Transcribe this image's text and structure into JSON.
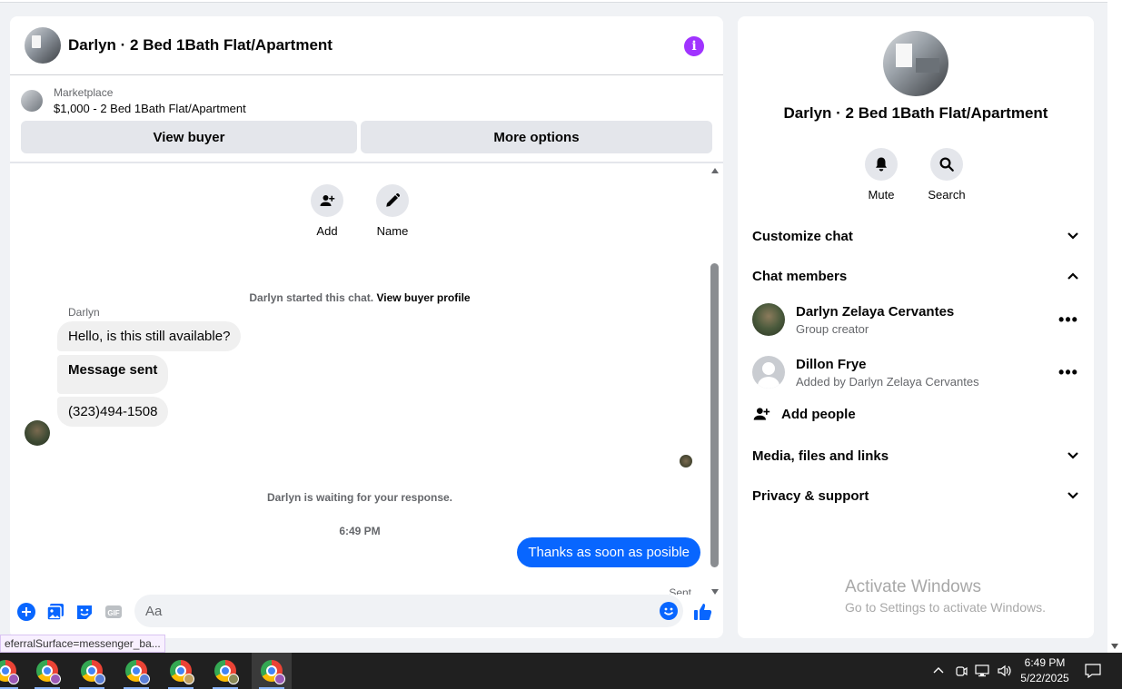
{
  "chat": {
    "title": "Darlyn · 2 Bed 1Bath Flat/Apartment",
    "marketplace_label": "Marketplace",
    "listing": "$1,000 - 2 Bed 1Bath Flat/Apartment",
    "view_buyer": "View buyer",
    "more_options": "More options",
    "add_label": "Add",
    "name_label": "Name",
    "started_text": "Darlyn started this chat.",
    "view_buyer_profile": "View buyer profile",
    "sender_name": "Darlyn",
    "messages": [
      "Hello, is this still available?",
      "Message sent",
      "(323)494-1508"
    ],
    "waiting_text": "Darlyn is waiting for your response.",
    "time": "6:49 PM",
    "outgoing": "Thanks as soon as posible",
    "sent_label": "Sent",
    "composer_placeholder": "Aa",
    "gif_label": "GIF"
  },
  "status_tip": "eferralSurface=messenger_ba...",
  "panel": {
    "title": "Darlyn · 2 Bed 1Bath Flat/Apartment",
    "mute": "Mute",
    "search": "Search",
    "customize_chat": "Customize chat",
    "chat_members": "Chat members",
    "members": [
      {
        "name": "Darlyn Zelaya Cervantes",
        "sub": "Group creator"
      },
      {
        "name": "Dillon Frye",
        "sub": "Added by Darlyn Zelaya Cervantes"
      }
    ],
    "add_people": "Add people",
    "media": "Media, files and links",
    "privacy": "Privacy & support"
  },
  "watermark": {
    "line1": "Activate Windows",
    "line2": "Go to Settings to activate Windows."
  },
  "taskbar": {
    "time": "6:49 PM",
    "date": "5/22/2025"
  },
  "colors": {
    "accent": "#0866ff",
    "info": "#a033ff"
  }
}
